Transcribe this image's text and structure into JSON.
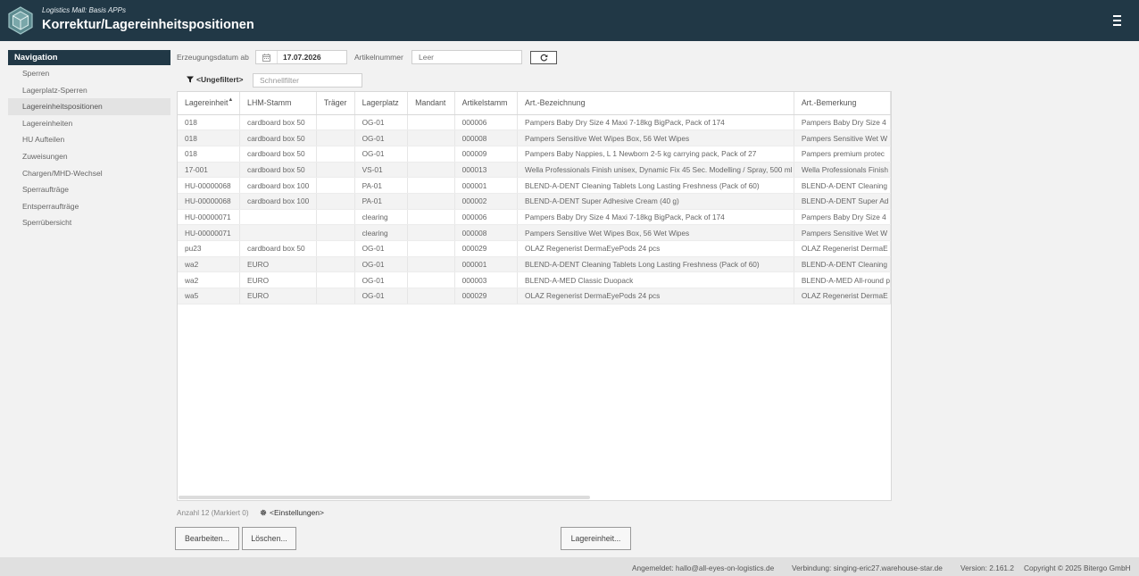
{
  "header": {
    "subtitle": "Logistics Mall: Basis APPs",
    "title": "Korrektur/Lagereinheitspositionen",
    "logo_icon": "hexagon-box-icon",
    "menu_icon": "hamburger-icon"
  },
  "nav": {
    "title": "Navigation",
    "items": [
      {
        "label": "Sperren",
        "active": false
      },
      {
        "label": "Lagerplatz-Sperren",
        "active": false
      },
      {
        "label": "Lagereinheitspositionen",
        "active": true
      },
      {
        "label": "Lagereinheiten",
        "active": false
      },
      {
        "label": "HU Aufteilen",
        "active": false
      },
      {
        "label": "Zuweisungen",
        "active": false
      },
      {
        "label": "Chargen/MHD-Wechsel",
        "active": false
      },
      {
        "label": "Sperraufträge",
        "active": false
      },
      {
        "label": "Entsperraufträge",
        "active": false
      },
      {
        "label": "Sperrübersicht",
        "active": false
      }
    ]
  },
  "filters": {
    "date_label": "Erzeugungsdatum ab",
    "date_value": "17.07.2026",
    "article_label": "Artikelnummer",
    "article_placeholder": "Leer",
    "unfiltered_label": "<Ungefiltert>",
    "quickfilter_placeholder": "Schnellfilter"
  },
  "table": {
    "columns": [
      "Lagereinheit",
      "LHM-Stamm",
      "Träger",
      "Lagerplatz",
      "Mandant",
      "Artikelstamm",
      "Art.-Bezeichnung",
      "Art.-Bemerkung"
    ],
    "rows": [
      [
        "018",
        "cardboard box 50",
        "",
        "OG-01",
        "",
        "000006",
        "Pampers Baby Dry Size 4 Maxi 7-18kg BigPack, Pack of 174",
        "Pampers Baby Dry Size 4"
      ],
      [
        "018",
        "cardboard box 50",
        "",
        "OG-01",
        "",
        "000008",
        "Pampers Sensitive Wet Wipes Box, 56 Wet Wipes",
        "Pampers Sensitive Wet W"
      ],
      [
        "018",
        "cardboard box 50",
        "",
        "OG-01",
        "",
        "000009",
        "Pampers Baby Nappies, L 1 Newborn 2-5 kg carrying pack, Pack of 27",
        "Pampers premium protec"
      ],
      [
        "17-001",
        "cardboard box 50",
        "",
        "VS-01",
        "",
        "000013",
        "Wella Professionals Finish unisex, Dynamic Fix 45 Sec. Modelling / Spray, 500 ml",
        "Wella Professionals Finish"
      ],
      [
        "HU-00000068",
        "cardboard box 100",
        "",
        "PA-01",
        "",
        "000001",
        "BLEND-A-DENT Cleaning Tablets Long Lasting Freshness (Pack of 60)",
        "BLEND-A-DENT Cleaning"
      ],
      [
        "HU-00000068",
        "cardboard box 100",
        "",
        "PA-01",
        "",
        "000002",
        "BLEND-A-DENT Super Adhesive Cream (40 g)",
        "BLEND-A-DENT Super Ad"
      ],
      [
        "HU-00000071",
        "",
        "",
        "clearing",
        "",
        "000006",
        "Pampers Baby Dry Size 4 Maxi 7-18kg BigPack, Pack of 174",
        "Pampers Baby Dry Size 4"
      ],
      [
        "HU-00000071",
        "",
        "",
        "clearing",
        "",
        "000008",
        "Pampers Sensitive Wet Wipes Box, 56 Wet Wipes",
        "Pampers Sensitive Wet W"
      ],
      [
        "pu23",
        "cardboard box 50",
        "",
        "OG-01",
        "",
        "000029",
        "OLAZ Regenerist DermaEyePods 24 pcs",
        "OLAZ Regenerist DermaE"
      ],
      [
        "wa2",
        "EURO",
        "",
        "OG-01",
        "",
        "000001",
        "BLEND-A-DENT Cleaning Tablets Long Lasting Freshness (Pack of 60)",
        "BLEND-A-DENT Cleaning"
      ],
      [
        "wa2",
        "EURO",
        "",
        "OG-01",
        "",
        "000003",
        "BLEND-A-MED Classic Duopack",
        "BLEND-A-MED All-round p"
      ],
      [
        "wa5",
        "EURO",
        "",
        "OG-01",
        "",
        "000029",
        "OLAZ Regenerist DermaEyePods 24 pcs",
        "OLAZ Regenerist DermaE"
      ]
    ]
  },
  "status": {
    "count_text": "Anzahl 12 (Markiert 0)",
    "settings_label": "<Einstellungen>"
  },
  "buttons": {
    "edit": "Bearbeiten...",
    "delete": "Löschen...",
    "unit": "Lagereinheit..."
  },
  "footer": {
    "logged_in": "Angemeldet: hallo@all-eyes-on-logistics.de",
    "connection": "Verbindung: singing-eric27.warehouse-star.de",
    "version": "Version: 2.161.2",
    "copyright": "Copyright © 2025 Bitergo GmbH"
  },
  "colors": {
    "header_bg": "#213846",
    "nav_active_bg": "#e3e3e3",
    "footer_bg": "#e0e0e0"
  }
}
